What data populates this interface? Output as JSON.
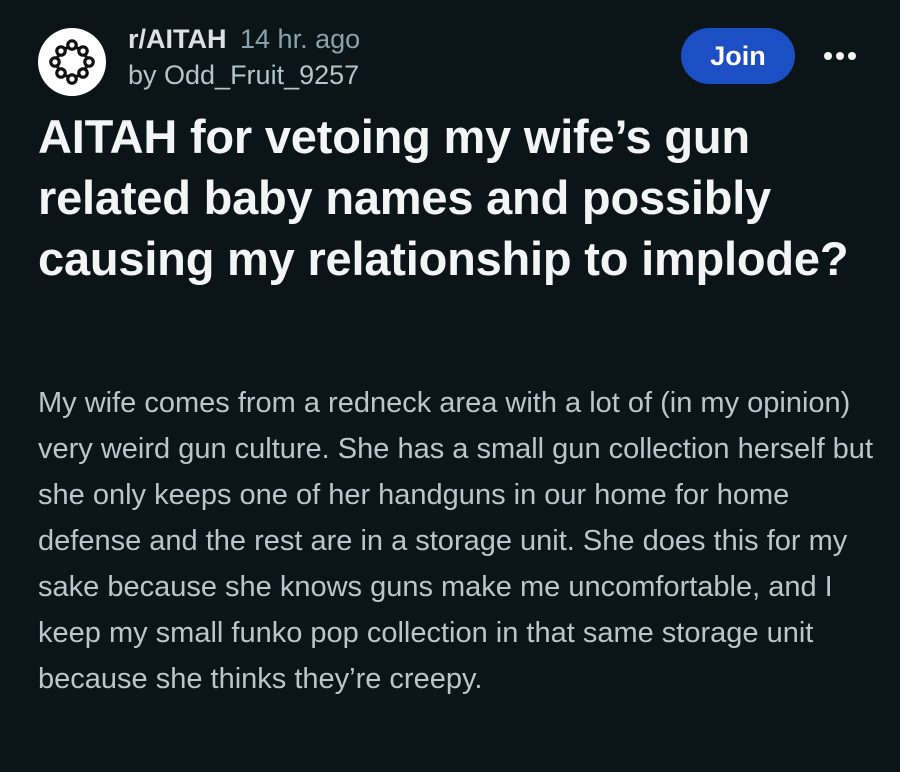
{
  "post": {
    "subreddit": "r/AITAH",
    "time_ago": "14 hr. ago",
    "author_line": "by Odd_Fruit_9257",
    "join_label": "Join",
    "title": "AITAH for vetoing my wife’s gun related baby names and possibly causing my relationship to implode?",
    "body": "My wife comes from a redneck area with a lot of (in my opinion) very weird gun culture. She has a small gun collection herself but she only keeps one of her handguns in our home for home defense and the rest are in a storage unit. She does this for my sake because she knows guns make me uncomfortable, and I keep my small funko pop collection in that same storage unit because she thinks they’re creepy."
  },
  "icons": {
    "avatar": "subreddit-community-icon",
    "more": "overflow-menu-icon"
  },
  "colors": {
    "background": "#0b1416",
    "join_button": "#1d4fc4",
    "text_primary": "#f2f4f5",
    "text_secondary": "#b9c6cc"
  }
}
